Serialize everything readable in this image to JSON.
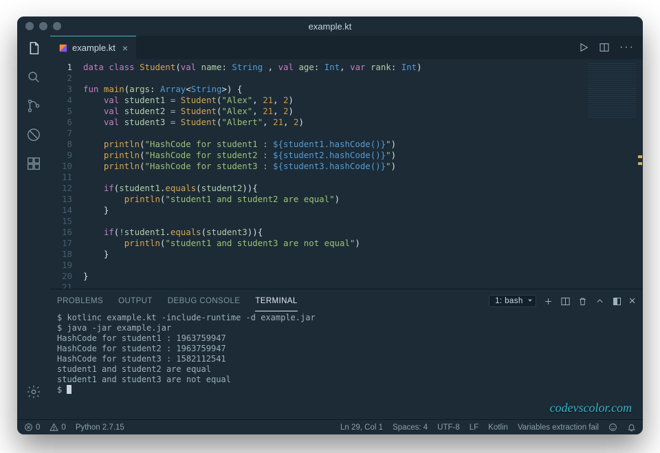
{
  "window_title": "example.kt",
  "tab": {
    "filename": "example.kt"
  },
  "code": {
    "lines": [
      {
        "raw": "data class Student(val name: String , val age: Int, var rank: Int)"
      },
      {
        "raw": ""
      },
      {
        "raw": "fun main(args: Array<String>) {"
      },
      {
        "raw": "    val student1 = Student(\"Alex\", 21, 2)"
      },
      {
        "raw": "    val student2 = Student(\"Alex\", 21, 2)"
      },
      {
        "raw": "    val student3 = Student(\"Albert\", 21, 2)"
      },
      {
        "raw": ""
      },
      {
        "raw": "    println(\"HashCode for student1 : ${student1.hashCode()}\")"
      },
      {
        "raw": "    println(\"HashCode for student2 : ${student2.hashCode()}\")"
      },
      {
        "raw": "    println(\"HashCode for student3 : ${student3.hashCode()}\")"
      },
      {
        "raw": ""
      },
      {
        "raw": "    if(student1.equals(student2)){"
      },
      {
        "raw": "        println(\"student1 and student2 are equal\")"
      },
      {
        "raw": "    }"
      },
      {
        "raw": ""
      },
      {
        "raw": "    if(!student1.equals(student3)){"
      },
      {
        "raw": "        println(\"student1 and student3 are not equal\")"
      },
      {
        "raw": "    }"
      },
      {
        "raw": ""
      },
      {
        "raw": "}"
      },
      {
        "raw": ""
      }
    ]
  },
  "panel": {
    "tabs": [
      "PROBLEMS",
      "OUTPUT",
      "DEBUG CONSOLE",
      "TERMINAL"
    ],
    "active": "TERMINAL",
    "terminal_select": "1: bash",
    "terminal_lines": [
      "$ kotlinc example.kt -include-runtime -d example.jar",
      "$ java -jar example.jar",
      "HashCode for student1 : 1963759947",
      "HashCode for student2 : 1963759947",
      "HashCode for student3 : 1582112541",
      "student1 and student2 are equal",
      "student1 and student3 are not equal"
    ],
    "prompt": "$ "
  },
  "status": {
    "errors": "0",
    "warnings": "0",
    "interpreter": "Python 2.7.15",
    "cursor": "Ln 29, Col 1",
    "spaces": "Spaces: 4",
    "encoding": "UTF-8",
    "eol": "LF",
    "language": "Kotlin",
    "right_msg": "Variables extraction fail"
  },
  "watermark": "codevscolor.com"
}
